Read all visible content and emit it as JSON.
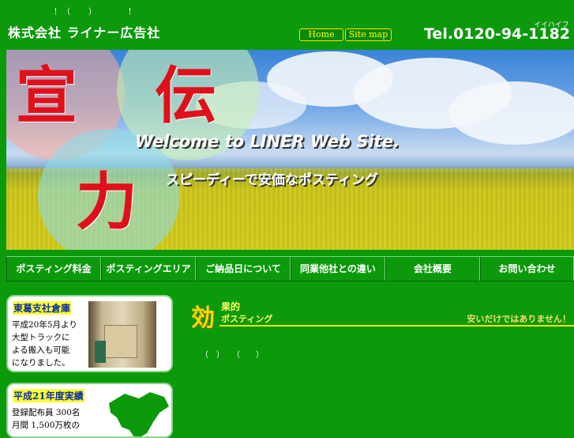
{
  "header": {
    "tagline": "！（　　）　　　　！",
    "company": "株式会社 ライナー広告社",
    "nav_links": [
      {
        "label": "Home"
      },
      {
        "label": "Site map"
      }
    ],
    "phone_kana": "イイハイフ",
    "phone": "Tel.0120-94-1182"
  },
  "hero": {
    "kanji": [
      "宣",
      "伝",
      "力"
    ],
    "welcome": "Welcome to LINER Web Site.",
    "slogan": "スピーディーで安価なポスティング"
  },
  "nav": {
    "items": [
      {
        "label": "ポスティング料金"
      },
      {
        "label": "ポスティングエリア"
      },
      {
        "label": "ご納品日について"
      },
      {
        "label": "同業他社との違い"
      },
      {
        "label": "会社概要"
      },
      {
        "label": "お問い合わせ"
      }
    ]
  },
  "sidebar": {
    "warehouse": {
      "title": "東葛支社倉庫",
      "lines": [
        "平成20年5月より",
        "大型トラックに",
        "よる搬入も可能",
        "になりました。"
      ]
    },
    "results": {
      "title": "平成21年度実績",
      "lines": [
        "登録配布員 300名",
        "月間 1,500万枚の"
      ]
    }
  },
  "main": {
    "heading_kanji": "効",
    "heading_line1": "果的",
    "heading_line2": "ポスティング",
    "heading_right": "安いだけではありません！",
    "paren_text": "（　）　　（　　）"
  },
  "colors": {
    "background": "#0a9a0a",
    "accent_yellow": "#ffe000",
    "kanji_red": "#e0101a",
    "title_blue": "#0b2fa0"
  }
}
